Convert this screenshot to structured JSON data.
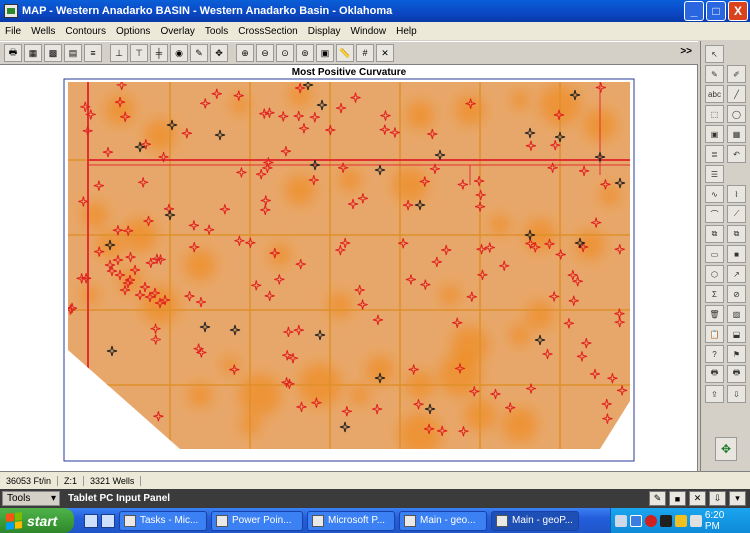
{
  "window": {
    "title": "MAP - Western Anadarko BASIN - Western Anadarko Basin - Oklahoma",
    "minimize": "_",
    "maximize": "□",
    "close": "X"
  },
  "menu": [
    "File",
    "Wells",
    "Contours",
    "Options",
    "Overlay",
    "Tools",
    "CrossSection",
    "Display",
    "Window",
    "Help"
  ],
  "toolbar": {
    "more": ">>"
  },
  "map": {
    "title": "Most Positive Curvature",
    "fill_color": "#e8a76a",
    "hot_color": "#f08a1e",
    "grid_color": "#e0902a",
    "road_color": "#e03030",
    "well_marker_color": "#e02020"
  },
  "status": {
    "scale": "36053 Ft/in",
    "zoom": "Z:1",
    "wells": "3321 Wells"
  },
  "tablet": {
    "tools_label": "Tools",
    "title": "Tablet PC Input Panel"
  },
  "taskbar": {
    "start": "start",
    "tasks": [
      "Tasks - Mic...",
      "Power Poin...",
      "Microsoft P...",
      "Main - geo...",
      "Main - geoP..."
    ],
    "clock": "6:20 PM"
  }
}
